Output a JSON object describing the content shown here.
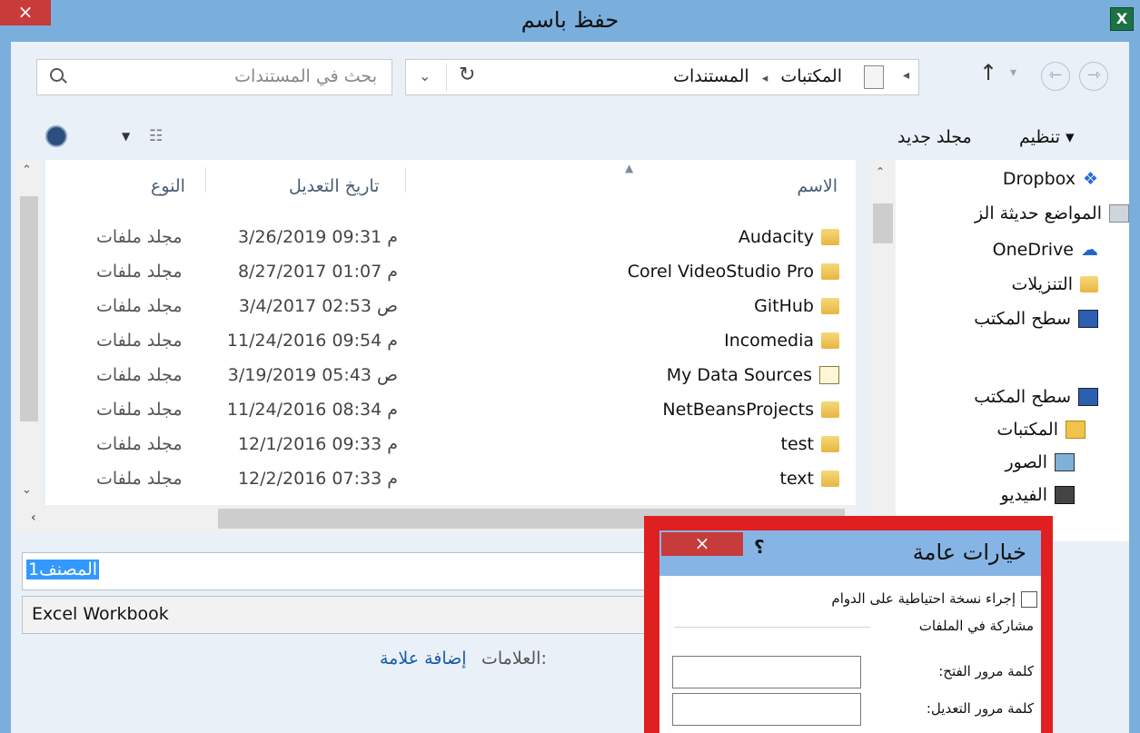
{
  "window": {
    "title": "حفظ باسم",
    "close_glyph": "×",
    "app_icon_letter": "X"
  },
  "address": {
    "path": [
      "المكتبات",
      "المستندات"
    ],
    "search_placeholder": "بحث في المستندات"
  },
  "toolbar": {
    "organize": "تنظيم ▾",
    "new_folder": "مجلد جديد"
  },
  "nav_pane": {
    "items": [
      "Dropbox",
      "المواضع حديثة الز",
      "OneDrive",
      "التنزيلات",
      "سطح المكتب",
      "سطح المكتب",
      "المكتبات",
      "الصور",
      "الفيديو"
    ]
  },
  "file_list": {
    "columns": {
      "name": "الاسم",
      "modified": "تاريخ التعديل",
      "type": "النوع"
    },
    "rows": [
      {
        "name": "Audacity",
        "date": "3/26/2019 09:31 م",
        "type": "مجلد ملفات"
      },
      {
        "name": "Corel VideoStudio Pro",
        "date": "8/27/2017 01:07 م",
        "type": "مجلد ملفات"
      },
      {
        "name": "GitHub",
        "date": "3/4/2017 02:53 ص",
        "type": "مجلد ملفات"
      },
      {
        "name": "Incomedia",
        "date": "11/24/2016 09:54 م",
        "type": "مجلد ملفات"
      },
      {
        "name": "My Data Sources",
        "date": "3/19/2019 05:43 ص",
        "type": "مجلد ملفات"
      },
      {
        "name": "NetBeansProjects",
        "date": "11/24/2016 08:34 م",
        "type": "مجلد ملفات"
      },
      {
        "name": "test",
        "date": "12/1/2016 09:33 م",
        "type": "مجلد ملفات"
      },
      {
        "name": "text",
        "date": "12/2/2016 07:33 م",
        "type": "مجلد ملفات"
      }
    ]
  },
  "save": {
    "file_name": "المصنف1",
    "file_type": "Excel Workbook",
    "tags_label": "العلامات:",
    "tags_link": "إضافة علامة"
  },
  "options_dialog": {
    "title": "خيارات عامة",
    "help_glyph": "؟",
    "close_glyph": "×",
    "always_backup": "إجراء نسخة احتياطية على الدوام",
    "sharing_group": "مشاركة في الملفات",
    "open_password_label": "كلمة مرور الفتح:",
    "modify_password_label": "كلمة مرور التعديل:"
  }
}
